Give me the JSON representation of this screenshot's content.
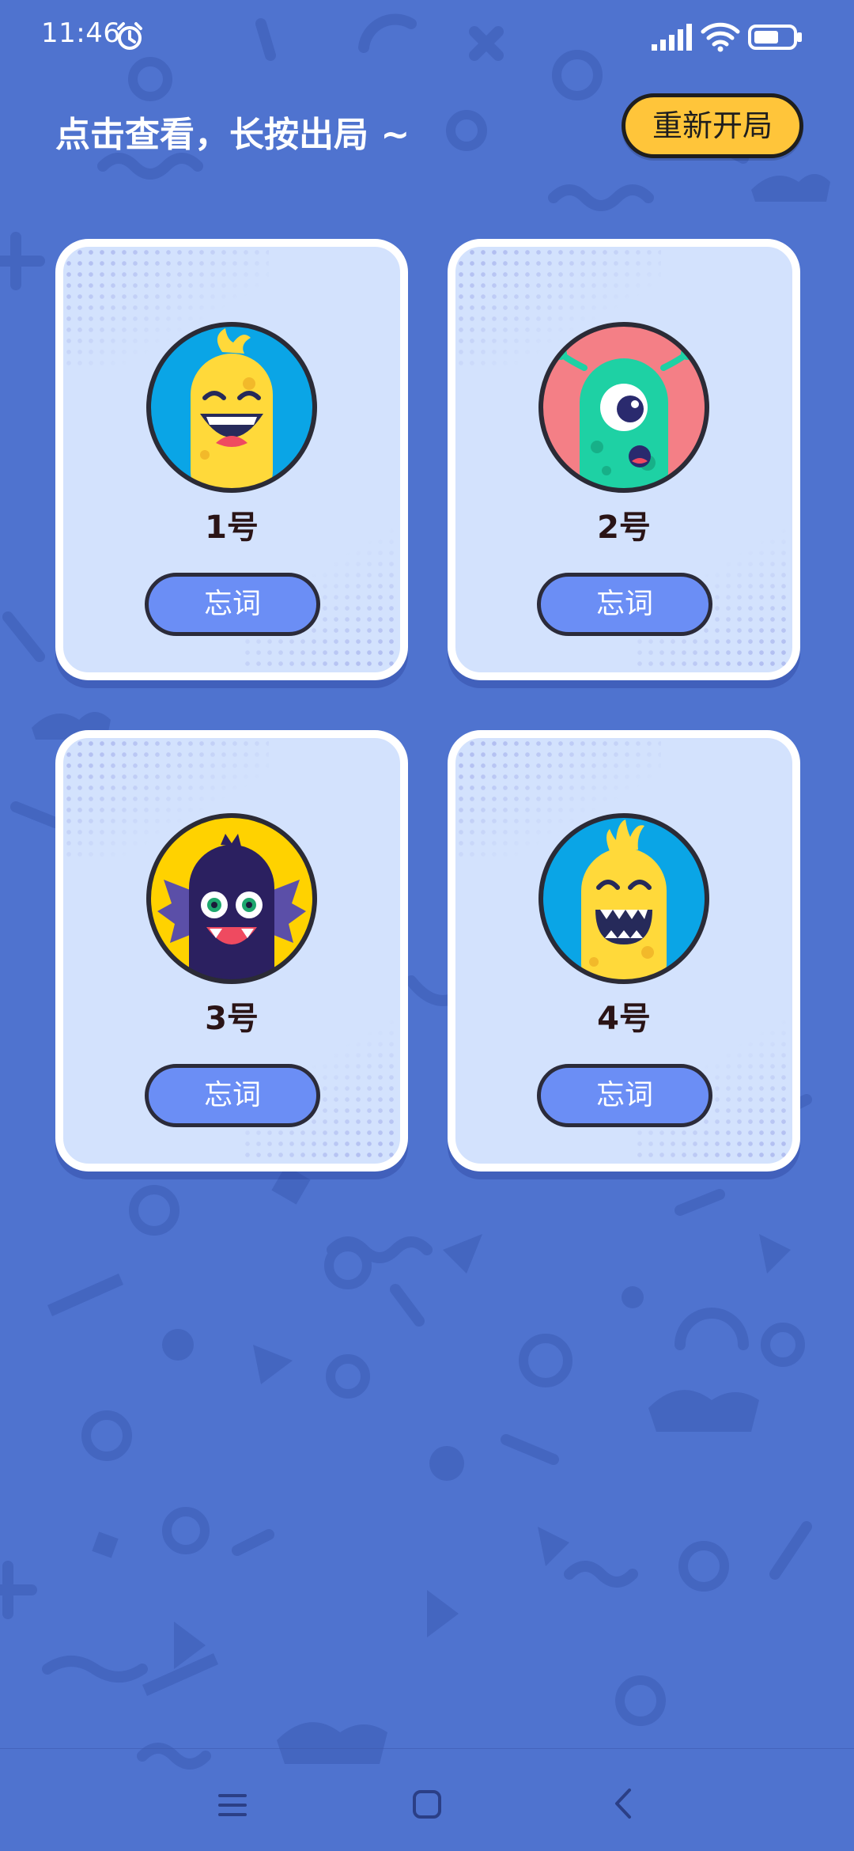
{
  "status_bar": {
    "time": "11:46",
    "icons": [
      "alarm-icon",
      "signal-icon",
      "wifi-icon",
      "battery-icon"
    ]
  },
  "header": {
    "hint": "点击查看，长按出局 ~",
    "restart_label": "重新开局"
  },
  "players": [
    {
      "label": "1号",
      "button_label": "忘词",
      "avatar": "yellow-monster-avatar",
      "avatar_bg": "#0aa5e6"
    },
    {
      "label": "2号",
      "button_label": "忘词",
      "avatar": "green-one-eyed-monster-avatar",
      "avatar_bg": "#f47f86"
    },
    {
      "label": "3号",
      "button_label": "忘词",
      "avatar": "purple-bat-monster-avatar",
      "avatar_bg": "#ffd200"
    },
    {
      "label": "4号",
      "button_label": "忘词",
      "avatar": "yellow-spiky-monster-avatar",
      "avatar_bg": "#0aa5e6"
    }
  ],
  "colors": {
    "background": "#4f73cf",
    "card": "#d3e2fd",
    "restart_button": "#ffc53a",
    "forget_button": "#6b8ef5"
  },
  "nav_bar": {
    "icons": [
      "menu-icon",
      "home-icon",
      "back-icon"
    ]
  }
}
